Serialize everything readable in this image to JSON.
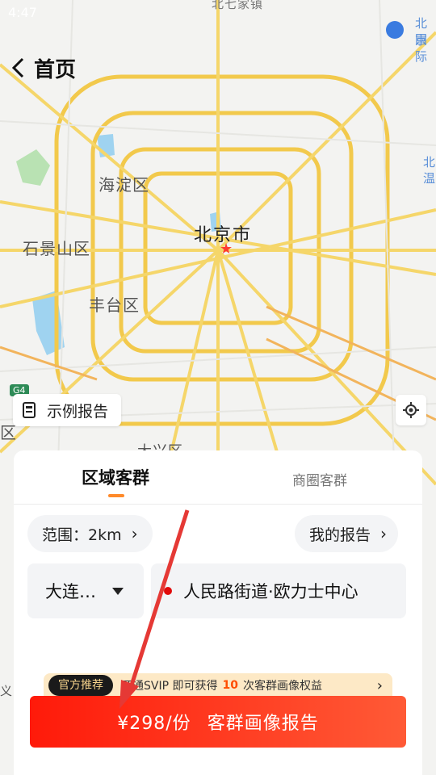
{
  "status_bar": {
    "time": "4:47",
    "battery": "▮"
  },
  "nav": {
    "title": "首页"
  },
  "map": {
    "labels": {
      "haidian": "海淀区",
      "beijing": "北京市",
      "shijingshan": "石景山区",
      "fengtai": "丰台区",
      "left_edge": "区",
      "bottom_partial": "大兴区",
      "top_partial": "北七家镇",
      "right_top": "北京",
      "right_top2": "国际",
      "right_mid": "北",
      "right_mid2": "温",
      "left_bottom": "义\n利"
    },
    "highway_badge": "G4",
    "road_color": "#f5d66a",
    "ring_color": "#f2c94c"
  },
  "sample_report": {
    "label": "示例报告",
    "icon": "report-icon"
  },
  "panel": {
    "tabs": [
      {
        "label": "区域客群",
        "active": true
      },
      {
        "label": "商圈客群",
        "active": false
      }
    ],
    "range": {
      "label": "范围：2km"
    },
    "my_report": {
      "label": "我的报告"
    },
    "city": {
      "label": "大连…"
    },
    "address": {
      "label": "人民路街道·欧力士中心"
    },
    "promo": {
      "tag": "官方推荐",
      "text_before": "开通SVIP 即可获得",
      "count": "10",
      "text_after": "次客群画像权益"
    },
    "buy_button": {
      "price": "¥298/份",
      "label": "客群画像报告"
    }
  },
  "colors": {
    "accent": "#ff8a2a",
    "button": "#ff2a12",
    "pin": "#e10a0a"
  }
}
